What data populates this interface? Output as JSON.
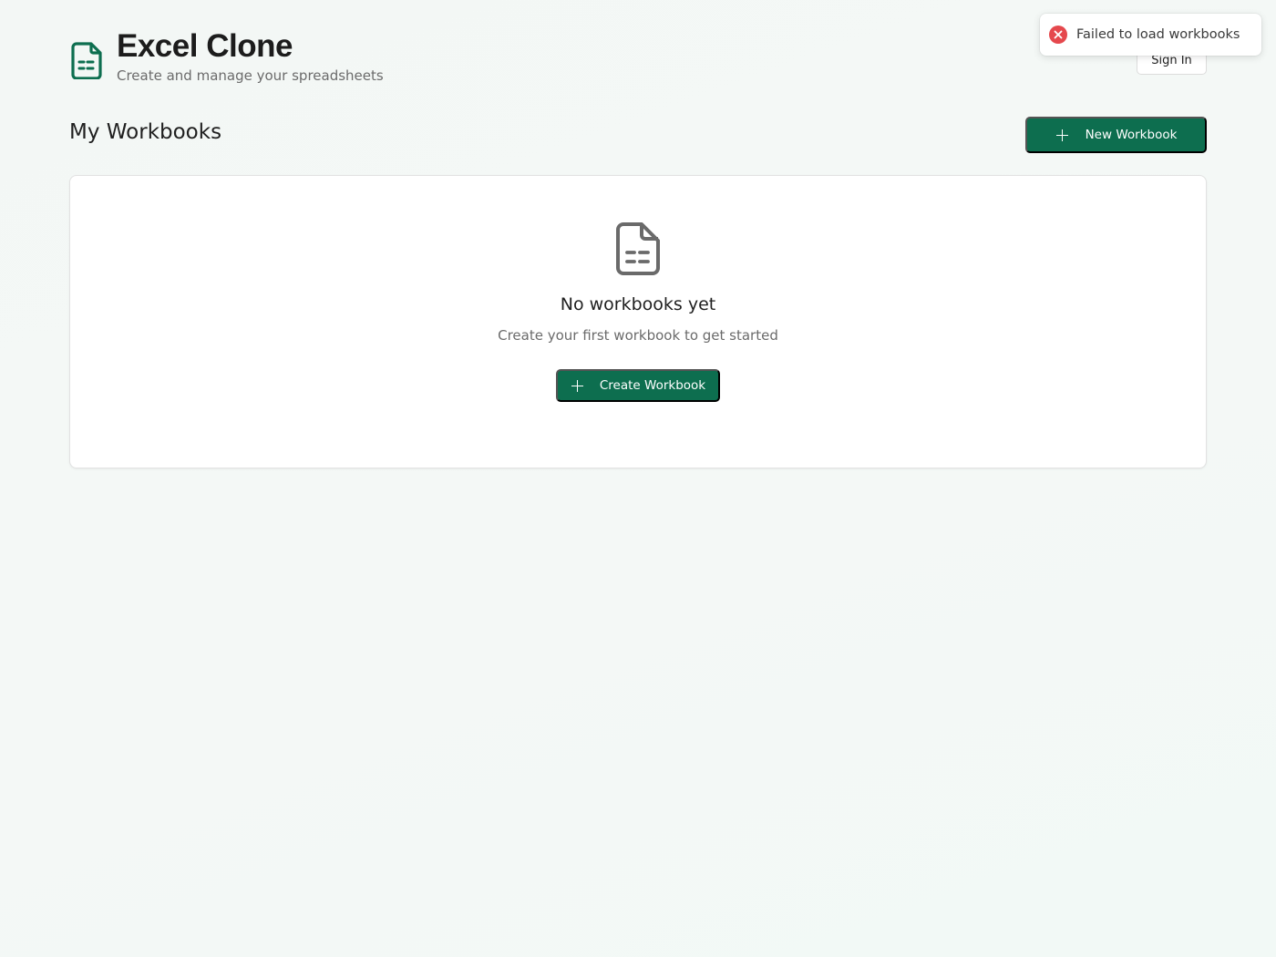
{
  "header": {
    "title": "Excel Clone",
    "subtitle": "Create and manage your spreadsheets",
    "logo_icon": "spreadsheet-file-icon",
    "sign_in_label": "Sign In"
  },
  "toast": {
    "type": "error",
    "icon": "error-x-icon",
    "message": "Failed to load workbooks"
  },
  "workbooks": {
    "section_title": "My Workbooks",
    "new_button_label": "New Workbook",
    "empty_state": {
      "icon": "spreadsheet-file-icon",
      "title": "No workbooks yet",
      "subtitle": "Create your first workbook to get started",
      "create_button_label": "Create Workbook"
    }
  },
  "colors": {
    "brand": "#0d6e4f",
    "error": "#e5484d",
    "background": "#f3f7f5"
  }
}
